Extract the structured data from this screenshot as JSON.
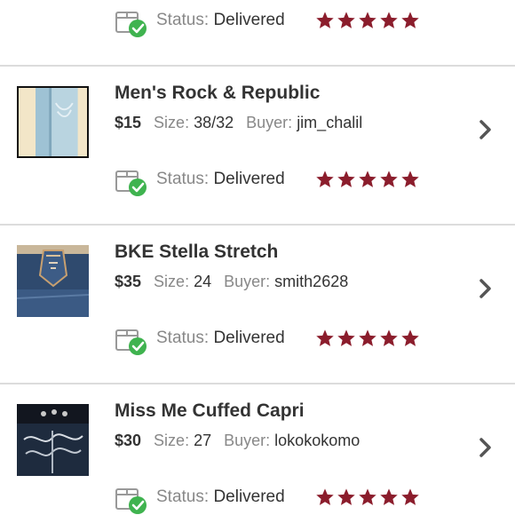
{
  "colors": {
    "accent": "#8b1d2c",
    "check": "#3fb34f",
    "divider": "#dcdcdc"
  },
  "labels": {
    "status": "Status:",
    "size": "Size:",
    "buyer": "Buyer:"
  },
  "top_status": {
    "status": "Delivered",
    "rating": 5
  },
  "items": [
    {
      "title": "Men's Rock & Republic",
      "price": "$15",
      "size": "38/32",
      "buyer": "jim_chalil",
      "status": "Delivered",
      "rating": 5,
      "icon": "chevron-right-icon"
    },
    {
      "title": "BKE Stella Stretch",
      "price": "$35",
      "size": "24",
      "buyer": "smith2628",
      "status": "Delivered",
      "rating": 5,
      "icon": "chevron-right-icon"
    },
    {
      "title": "Miss Me Cuffed Capri",
      "price": "$30",
      "size": "27",
      "buyer": "lokokokomo",
      "status": "Delivered",
      "rating": 5,
      "icon": "chevron-right-icon"
    }
  ]
}
